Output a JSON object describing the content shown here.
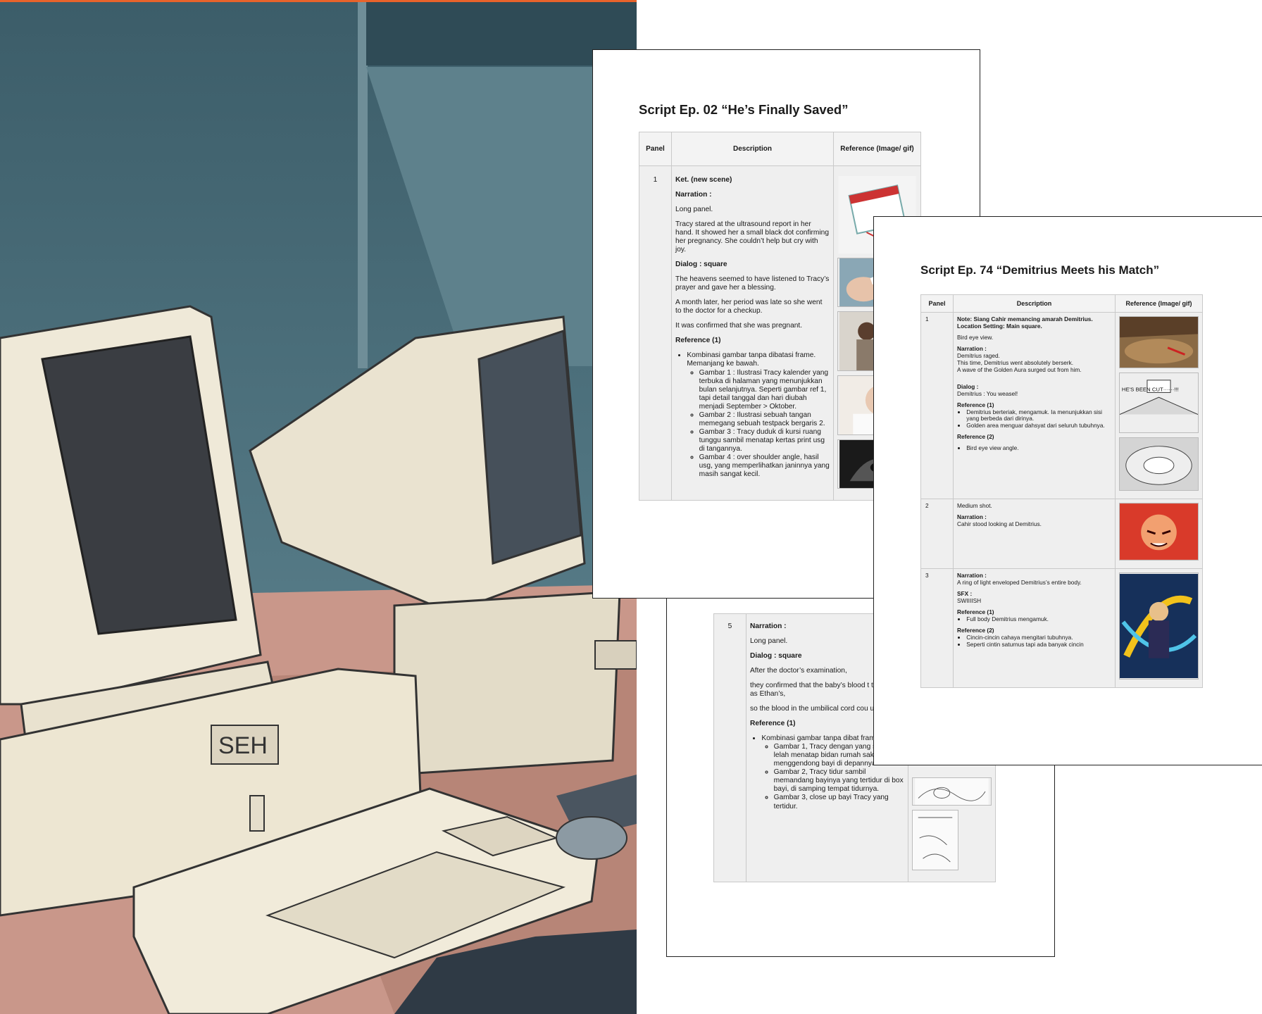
{
  "illustration": {
    "caption": "",
    "palette": {
      "wall": "#4a6d78",
      "desk": "#c9978a",
      "computer": "#efe9d8",
      "screen": "#3a3d42",
      "accent": "#e8632b"
    }
  },
  "doc1": {
    "title": "Script Ep. 02 “He’s Finally Saved”",
    "headers": {
      "panel": "Panel",
      "description": "Description",
      "reference": "Reference (Image/ gif)"
    },
    "row": {
      "panel": "1",
      "ket": "Ket.  (new scene)",
      "narration_label": "Narration :",
      "long_panel": "Long panel.",
      "narration_text": "Tracy  stared at the ultrasound report in her hand. It showed her a small black dot confirming her pregnancy. She couldn’t help but cry with joy.",
      "dialog_label": "Dialog : square",
      "dialog_1": "The heavens seemed to have listened to Tracy’s prayer and gave her a blessing.",
      "dialog_2": "A month later, her period was late so she went to the doctor for a checkup.",
      "dialog_3": "It was confirmed that she was pregnant.",
      "reference_label": "Reference (1)",
      "bullet": "Kombinasi gambar tanpa dibatasi frame. Memanjang ke bawah.",
      "sub": [
        "Gambar 1 : Ilustrasi Tracy kalender yang terbuka di halaman yang menunjukkan bulan selanjutnya. Seperti gambar ref 1, tapi detail tanggal dan hari diubah menjadi September > Oktober.",
        "Gambar 2 : Ilustrasi sebuah tangan memegang sebuah testpack bergaris 2.",
        "Gambar 3 : Tracy duduk di kursi ruang tunggu sambil menatap kertas print usg di tangannya.",
        "Gambar 4 : over shoulder angle, hasil usg, yang memperlihatkan janinnya yang masih sangat kecil."
      ]
    }
  },
  "doc3": {
    "row": {
      "panel": "5",
      "narration_label": "Narration :",
      "long_panel": "Long panel.",
      "dialog_label": "Dialog : square",
      "dialog_1": "After the doctor’s examination,",
      "dialog_2": "they confirmed that the baby’s blood t the same as Ethan’s,",
      "dialog_3": "so the blood in the umbilical cord cou used.",
      "reference_label": "Reference (1)",
      "bullet": "Kombinasi gambar tanpa dibat frame.",
      "sub": [
        "Gambar 1, Tracy dengan yang sangat lelah menatap bidan rumah sakit yang menggendong bayi di depannya.",
        "Gambar 2, Tracy tidur sambil memandang bayinya yang tertidur di box bayi, di samping tempat tidurnya.",
        "Gambar 3, close up bayi Tracy yang tertidur."
      ]
    }
  },
  "doc2": {
    "title": "Script Ep. 74 “Demitrius Meets his Match”",
    "headers": {
      "panel": "Panel",
      "description": "Description",
      "reference": "Reference (Image/ gif)"
    },
    "rows": [
      {
        "panel": "1",
        "note": "Note: Siang Cahir memancing amarah Demitrius.",
        "location": "Location Setting: Main square.",
        "shot": "Bird eye view.",
        "narration_label": "Narration :",
        "narration_lines": [
          "Demitrius raged.",
          "This time, Demitrius went absolutely berserk.",
          "A wave of the Golden Aura surged out from him."
        ],
        "dialog_label": "Dialog :",
        "dialog": "Demitrius : You weasel!",
        "ref1_label": "Reference (1)",
        "ref1": [
          "Demitrius berteriak, mengamuk. Ia menunjukkan sisi yang berbeda dari dirinya.",
          "Golden area menguar dahsyat dari seluruh tubuhnya."
        ],
        "ref2_label": "Reference (2)",
        "ref2": [
          "Bird eye view angle."
        ],
        "img_text": "HE'S BEEN CUT······!!!"
      },
      {
        "panel": "2",
        "shot": "Medium shot.",
        "narration_label": "Narration :",
        "narration": "Cahir stood looking at Demitrius."
      },
      {
        "panel": "3",
        "narration_label": "Narration :",
        "narration": "A ring of light enveloped Demitrius’s entire body.",
        "sfx_label": "SFX :",
        "sfx": "SWIIIISH",
        "ref1_label": "Reference (1)",
        "ref1": [
          "Full body Demitrius mengamuk."
        ],
        "ref2_label": "Reference (2)",
        "ref2": [
          "Cincin-cincin cahaya mengitari tubuhnya.",
          "Seperti cintin saturnus tapi ada banyak cincin"
        ]
      }
    ]
  }
}
